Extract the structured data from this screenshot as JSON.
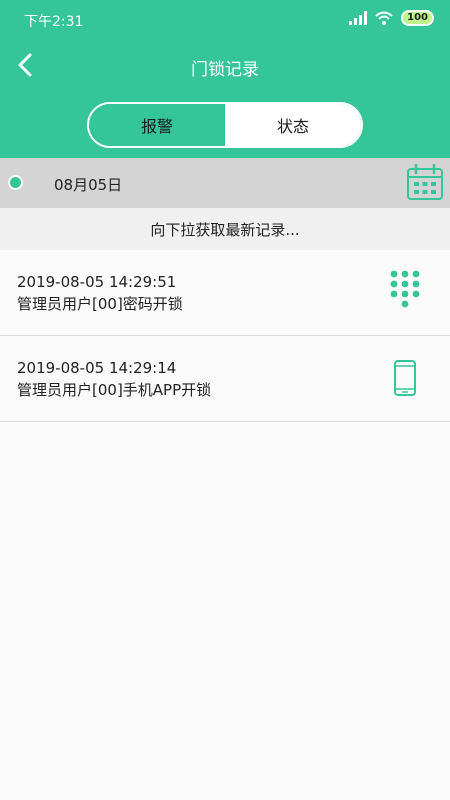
{
  "status_bar": {
    "time": "下午2:31",
    "battery": "100",
    "icons": [
      "signal-icon",
      "wifi-icon",
      "battery-icon"
    ]
  },
  "nav": {
    "title": "门锁记录",
    "back_icon": "back-arrow-icon"
  },
  "tabs": [
    {
      "label": "报警",
      "active": true
    },
    {
      "label": "状态",
      "active": false
    }
  ],
  "date_bar": {
    "date": "08月05日",
    "icon": "calendar-icon"
  },
  "pull_hint": "向下拉获取最新记录...",
  "records": [
    {
      "time": "2019-08-05 14:29:51",
      "description": "管理员用户[00]密码开锁",
      "icon": "keypad-icon"
    },
    {
      "time": "2019-08-05 14:29:14",
      "description": "管理员用户[00]手机APP开锁",
      "icon": "phone-icon"
    }
  ],
  "colors": {
    "brand": "#34c698",
    "date_bar_bg": "#d4d4d4",
    "hint_bg": "#f0f0f0",
    "battery": "#bff28a"
  }
}
